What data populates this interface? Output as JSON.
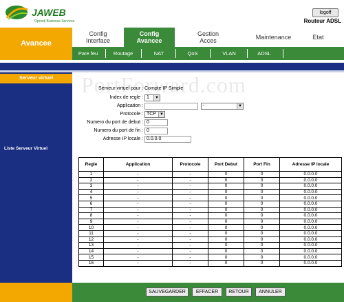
{
  "header": {
    "brand": "JAWEB",
    "tagline": "Opendi Business Services",
    "logout_label": "logoff",
    "router_title": "Routeur ADSL",
    "brand_color": "#2a8a2a"
  },
  "nav": {
    "section_label": "Avancee",
    "tabs": [
      {
        "line1": "Config",
        "line2": "Interface"
      },
      {
        "line1": "Config",
        "line2": "Avancee"
      },
      {
        "line1": "Gestion",
        "line2": "Acces"
      },
      {
        "line1": "Maintenance",
        "line2": ""
      },
      {
        "line1": "Etat",
        "line2": ""
      }
    ],
    "subtabs": [
      "Pare feu",
      "Routage",
      "NAT",
      "QoS",
      "VLAN",
      "ADSL"
    ]
  },
  "sidebar": {
    "title": "Serveur virtuel",
    "list_title": "Liste Serveur Virtuel"
  },
  "watermark": "PortForward.com",
  "form": {
    "label_server": "Serveur virtuel pour :",
    "value_server": "Compte IP Simple",
    "label_index": "Index de regle :",
    "value_index": "1",
    "label_app": "Application :",
    "value_app": "",
    "value_app2": "-",
    "label_proto": "Protocole :",
    "value_proto": "TCP",
    "label_port_start": "Numero du port de debut :",
    "value_port_start": "0",
    "label_port_end": "Numero du port de fin :",
    "value_port_end": "0",
    "label_ip": "Adresse IP locale :",
    "value_ip": "0.0.0.0"
  },
  "table": {
    "headers": [
      "Regle",
      "Application",
      "Protocole",
      "Port Debut",
      "Port Fin",
      "Adresse IP locale"
    ],
    "rows": [
      [
        "1",
        "-",
        "-",
        "0",
        "0",
        "0.0.0.0"
      ],
      [
        "2",
        "-",
        "-",
        "0",
        "0",
        "0.0.0.0"
      ],
      [
        "3",
        "-",
        "-",
        "0",
        "0",
        "0.0.0.0"
      ],
      [
        "4",
        "-",
        "-",
        "0",
        "0",
        "0.0.0.0"
      ],
      [
        "5",
        "-",
        "-",
        "0",
        "0",
        "0.0.0.0"
      ],
      [
        "6",
        "-",
        "-",
        "0",
        "0",
        "0.0.0.0"
      ],
      [
        "7",
        "-",
        "-",
        "0",
        "0",
        "0.0.0.0"
      ],
      [
        "8",
        "-",
        "-",
        "0",
        "0",
        "0.0.0.0"
      ],
      [
        "9",
        "-",
        "-",
        "0",
        "0",
        "0.0.0.0"
      ],
      [
        "10",
        "-",
        "-",
        "0",
        "0",
        "0.0.0.0"
      ],
      [
        "11",
        "-",
        "-",
        "0",
        "0",
        "0.0.0.0"
      ],
      [
        "12",
        "-",
        "-",
        "0",
        "0",
        "0.0.0.0"
      ],
      [
        "13",
        "-",
        "-",
        "0",
        "0",
        "0.0.0.0"
      ],
      [
        "14",
        "-",
        "-",
        "0",
        "0",
        "0.0.0.0"
      ],
      [
        "15",
        "-",
        "-",
        "0",
        "0",
        "0.0.0.0"
      ],
      [
        "16",
        "-",
        "-",
        "0",
        "0",
        "0.0.0.0"
      ]
    ]
  },
  "buttons": {
    "save": "SAUVEGARDER",
    "clear": "EFFACER",
    "back": "RETOUR",
    "cancel": "ANNULER"
  }
}
